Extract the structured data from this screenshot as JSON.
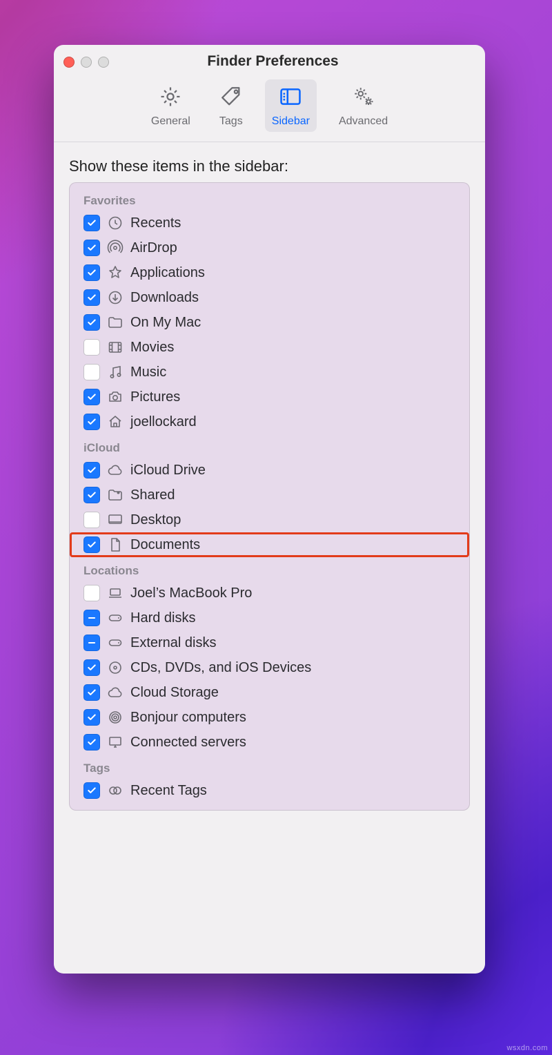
{
  "window": {
    "title": "Finder Preferences"
  },
  "tabs": {
    "general": "General",
    "tags": "Tags",
    "sidebar": "Sidebar",
    "advanced": "Advanced",
    "active": "sidebar"
  },
  "prompt": "Show these items in the sidebar:",
  "sections": {
    "favorites": {
      "heading": "Favorites",
      "items": [
        {
          "id": "recents",
          "label": "Recents",
          "checked": "check",
          "icon": "clock"
        },
        {
          "id": "airdrop",
          "label": "AirDrop",
          "checked": "check",
          "icon": "airdrop"
        },
        {
          "id": "applications",
          "label": "Applications",
          "checked": "check",
          "icon": "apps"
        },
        {
          "id": "downloads",
          "label": "Downloads",
          "checked": "check",
          "icon": "download"
        },
        {
          "id": "onmymac",
          "label": "On My Mac",
          "checked": "check",
          "icon": "folder"
        },
        {
          "id": "movies",
          "label": "Movies",
          "checked": "empty",
          "icon": "film"
        },
        {
          "id": "music",
          "label": "Music",
          "checked": "empty",
          "icon": "note"
        },
        {
          "id": "pictures",
          "label": "Pictures",
          "checked": "check",
          "icon": "camera"
        },
        {
          "id": "home",
          "label": "joellockard",
          "checked": "check",
          "icon": "house"
        }
      ]
    },
    "icloud": {
      "heading": "iCloud",
      "items": [
        {
          "id": "iclouddrive",
          "label": "iCloud Drive",
          "checked": "check",
          "icon": "cloud"
        },
        {
          "id": "shared",
          "label": "Shared",
          "checked": "check",
          "icon": "sharedfolder"
        },
        {
          "id": "desktop",
          "label": "Desktop",
          "checked": "empty",
          "icon": "desktop"
        },
        {
          "id": "documents",
          "label": "Documents",
          "checked": "check",
          "icon": "doc",
          "highlight": true
        }
      ]
    },
    "locations": {
      "heading": "Locations",
      "items": [
        {
          "id": "thismac",
          "label": "Joel’s MacBook Pro",
          "checked": "empty",
          "icon": "laptop"
        },
        {
          "id": "harddisks",
          "label": "Hard disks",
          "checked": "minus",
          "icon": "disk"
        },
        {
          "id": "extdisks",
          "label": "External disks",
          "checked": "minus",
          "icon": "disk"
        },
        {
          "id": "discs",
          "label": "CDs, DVDs, and iOS Devices",
          "checked": "check",
          "icon": "disc"
        },
        {
          "id": "cloudstorage",
          "label": "Cloud Storage",
          "checked": "check",
          "icon": "cloud"
        },
        {
          "id": "bonjour",
          "label": "Bonjour computers",
          "checked": "check",
          "icon": "bonjour"
        },
        {
          "id": "connected",
          "label": "Connected servers",
          "checked": "check",
          "icon": "server"
        }
      ]
    },
    "tags": {
      "heading": "Tags",
      "items": [
        {
          "id": "recenttags",
          "label": "Recent Tags",
          "checked": "check",
          "icon": "tagstack"
        }
      ]
    }
  },
  "watermark": "wsxdn.com"
}
